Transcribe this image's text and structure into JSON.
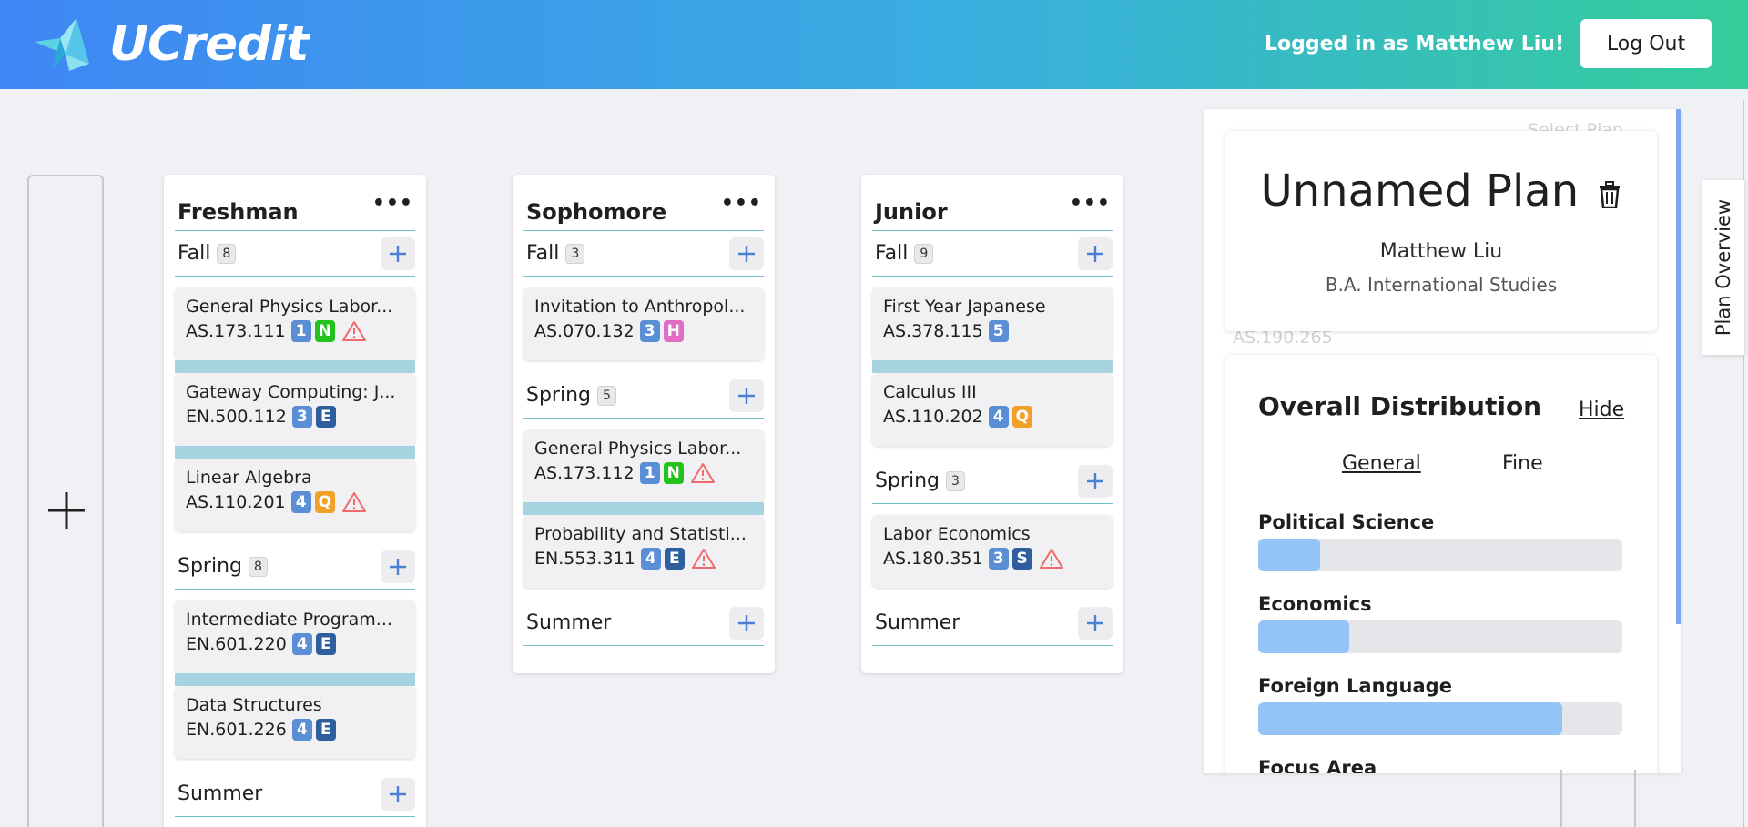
{
  "header": {
    "brand": "UCredit",
    "login_text": "Logged in as Matthew Liu!",
    "logout_label": "Log Out",
    "colors": {
      "gradient_start": "#3f86f5",
      "gradient_end": "#35cd9b"
    }
  },
  "years": [
    {
      "name": "Freshman",
      "semesters": [
        {
          "name": "Fall",
          "count": "8",
          "courses": [
            {
              "title": "General Physics Labor...",
              "number": "AS.173.111",
              "credits": "1",
              "area": "N",
              "warning": true,
              "linked": true
            },
            {
              "title": "Gateway Computing: J...",
              "number": "EN.500.112",
              "credits": "3",
              "area": "E",
              "warning": false,
              "linked": true
            },
            {
              "title": "Linear Algebra",
              "number": "AS.110.201",
              "credits": "4",
              "area": "Q",
              "warning": true,
              "linked": false
            }
          ]
        },
        {
          "name": "Spring",
          "count": "8",
          "courses": [
            {
              "title": "Intermediate Program...",
              "number": "EN.601.220",
              "credits": "4",
              "area": "E",
              "warning": false,
              "linked": true
            },
            {
              "title": "Data Structures",
              "number": "EN.601.226",
              "credits": "4",
              "area": "E",
              "warning": false,
              "linked": false
            }
          ]
        },
        {
          "name": "Summer",
          "count": "",
          "courses": []
        }
      ]
    },
    {
      "name": "Sophomore",
      "semesters": [
        {
          "name": "Fall",
          "count": "3",
          "courses": [
            {
              "title": "Invitation to Anthropol...",
              "number": "AS.070.132",
              "credits": "3",
              "area": "H",
              "warning": false,
              "linked": false
            }
          ]
        },
        {
          "name": "Spring",
          "count": "5",
          "courses": [
            {
              "title": "General Physics Labor...",
              "number": "AS.173.112",
              "credits": "1",
              "area": "N",
              "warning": true,
              "linked": true
            },
            {
              "title": "Probability and Statisti...",
              "number": "EN.553.311",
              "credits": "4",
              "area": "E",
              "warning": true,
              "linked": false
            }
          ]
        },
        {
          "name": "Summer",
          "count": "",
          "courses": []
        }
      ]
    },
    {
      "name": "Junior",
      "semesters": [
        {
          "name": "Fall",
          "count": "9",
          "courses": [
            {
              "title": "First Year Japanese",
              "number": "AS.378.115",
              "credits": "5",
              "area": "",
              "warning": false,
              "linked": true
            },
            {
              "title": "Calculus III",
              "number": "AS.110.202",
              "credits": "4",
              "area": "Q",
              "warning": false,
              "linked": false
            }
          ]
        },
        {
          "name": "Spring",
          "count": "3",
          "courses": [
            {
              "title": "Labor Economics",
              "number": "AS.180.351",
              "credits": "3",
              "area": "S",
              "warning": true,
              "linked": false
            }
          ]
        },
        {
          "name": "Summer",
          "count": "",
          "courses": []
        }
      ]
    }
  ],
  "plan": {
    "ghost_select": "Select Plan",
    "ghost_course": "AS.190.265",
    "title": "Unnamed Plan",
    "user": "Matthew Liu",
    "major": "B.A. International Studies"
  },
  "distribution": {
    "title": "Overall Distribution",
    "hide_label": "Hide",
    "tab_general": "General",
    "tab_fine": "Fine",
    "rows": [
      {
        "label": "Political Science",
        "fill": 0.17
      },
      {
        "label": "Economics",
        "fill": 0.25
      },
      {
        "label": "Foreign Language",
        "fill": 0.835
      },
      {
        "label": "Focus Area",
        "fill": 0
      }
    ]
  },
  "overview_tab_label": "Plan Overview"
}
